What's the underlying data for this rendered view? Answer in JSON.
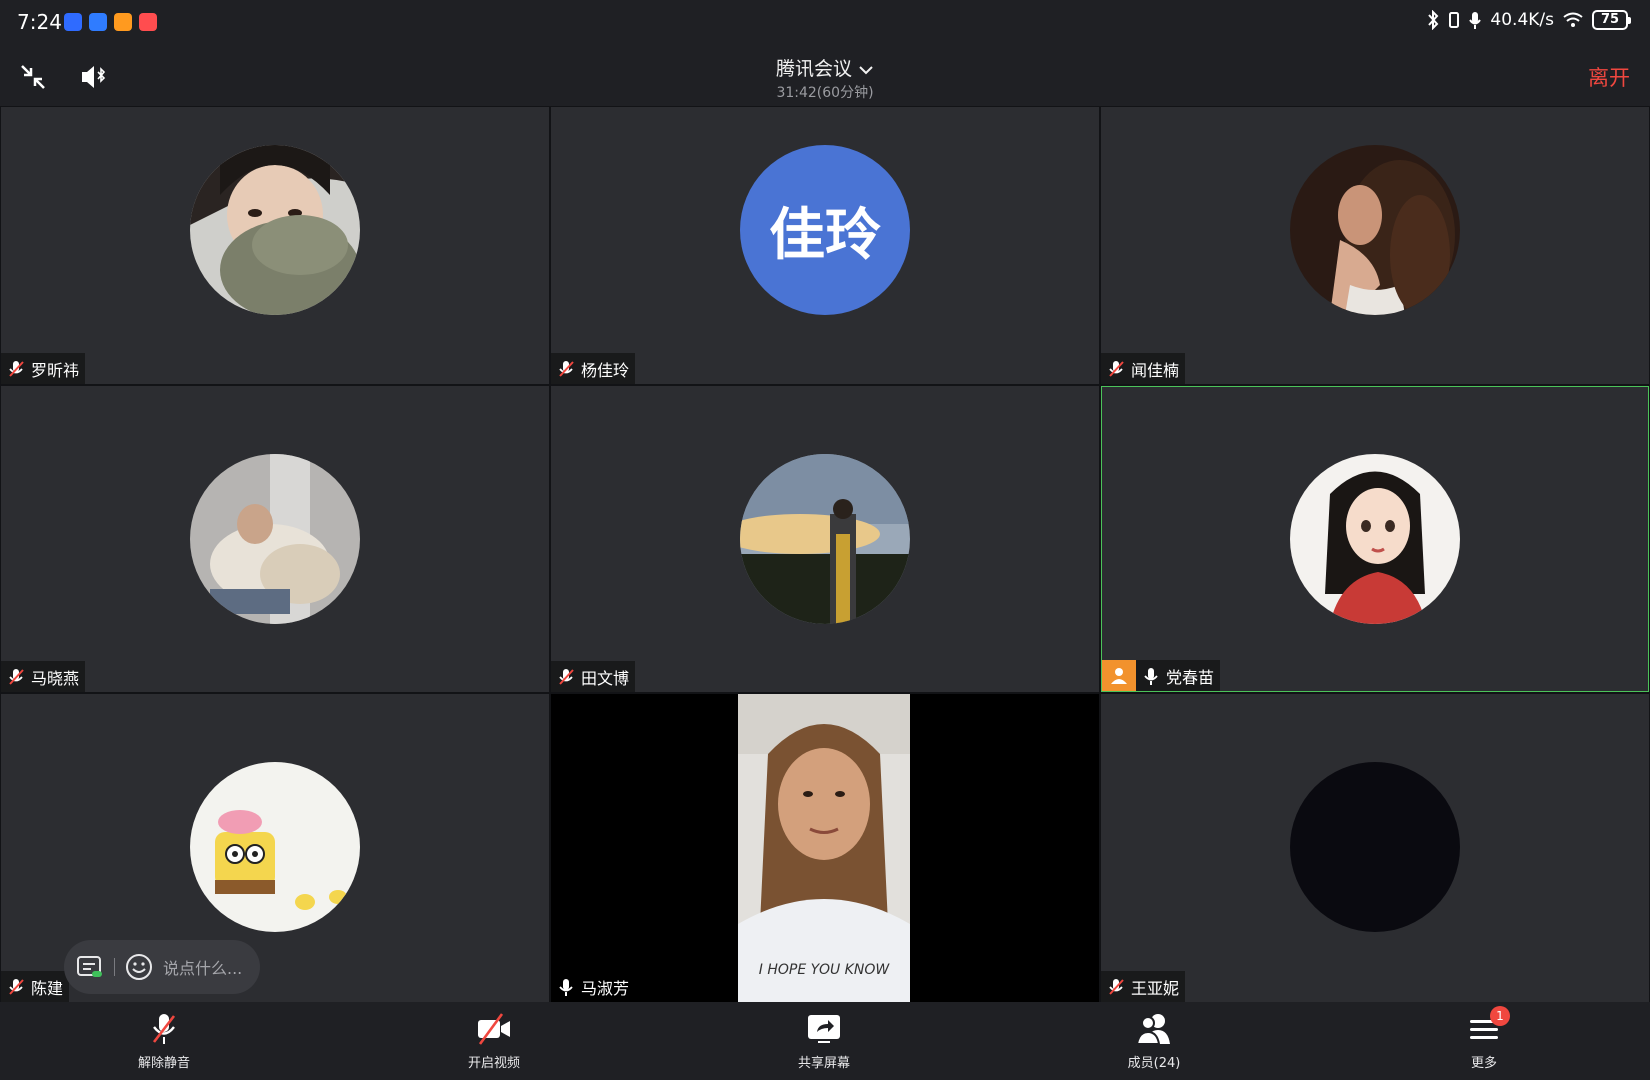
{
  "status_bar": {
    "time": "7:24",
    "net_speed": "40.4K/s",
    "battery": "75",
    "app_icon_colors": [
      "#2f6bff",
      "#2f7cff",
      "#ff9a1f",
      "#ff4d4f"
    ]
  },
  "toolbar": {
    "title": "腾讯会议",
    "duration": "31:42(60分钟)",
    "leave_label": "离开"
  },
  "participants": [
    {
      "name": "罗昕祎",
      "avatar": "photo",
      "mic": "muted"
    },
    {
      "name": "杨佳玲",
      "avatar_text": "佳玲",
      "avatar_color": "#4a74d4",
      "mic": "muted"
    },
    {
      "name": "闻佳楠",
      "avatar": "photo",
      "mic": "muted"
    },
    {
      "name": "马晓燕",
      "avatar": "photo",
      "mic": "muted"
    },
    {
      "name": "田文博",
      "avatar": "photo",
      "mic": "muted"
    },
    {
      "name": "党春苗",
      "avatar": "illustration",
      "mic": "on",
      "host": true,
      "active_speaker": true
    },
    {
      "name": "陈建",
      "avatar": "cartoon",
      "mic": "muted"
    },
    {
      "name": "马淑芳",
      "avatar": "video",
      "mic": "on",
      "video_caption": "I HOPE YOU KNOW"
    },
    {
      "name": "王亚妮",
      "avatar": "dark",
      "mic": "muted"
    }
  ],
  "chat": {
    "placeholder": "说点什么..."
  },
  "bottom_bar": {
    "items": [
      {
        "label": "解除静音",
        "icon": "mic-muted-icon"
      },
      {
        "label": "开启视频",
        "icon": "video-off-icon"
      },
      {
        "label": "共享屏幕",
        "icon": "share-screen-icon"
      },
      {
        "label": "成员(24)",
        "icon": "members-icon"
      },
      {
        "label": "更多",
        "icon": "more-icon",
        "badge": "1"
      }
    ]
  },
  "colors": {
    "leave": "#f0473f",
    "active_border": "#4cc35a",
    "host_badge": "#f2922d"
  }
}
